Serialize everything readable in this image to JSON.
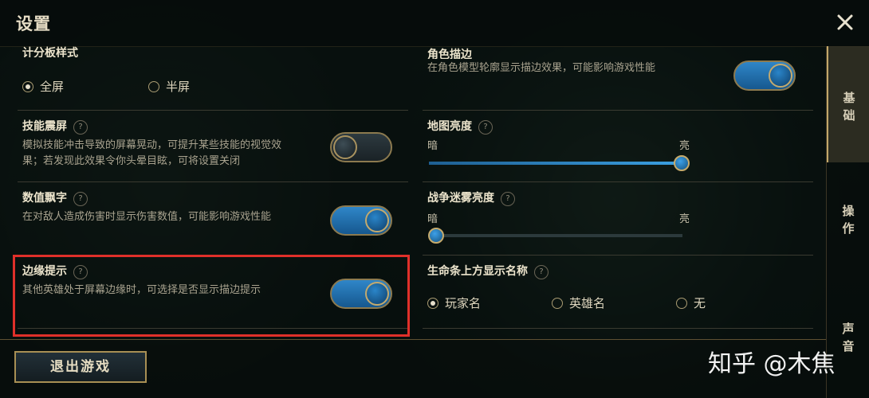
{
  "window": {
    "title": "设置"
  },
  "nav": {
    "tabs": [
      {
        "label": "基础"
      },
      {
        "label": "操作"
      },
      {
        "label": "声音"
      }
    ]
  },
  "sections": {
    "score_panel": {
      "name": "计分板样式",
      "options": [
        "全屏",
        "半屏"
      ],
      "selected": "全屏"
    },
    "outline": {
      "name": "角色描边",
      "desc": "在角色模型轮廓显示描边效果，可能影响游戏性能",
      "toggle": "on"
    },
    "shake": {
      "name": "技能震屏",
      "desc_1": "模拟技能冲击导致的屏幕晃动，可提升某些技能的视觉效",
      "desc_2": "果；若发现此效果令你头晕目眩，可将设置关闭",
      "toggle": "off"
    },
    "map_brightness": {
      "name": "地图亮度",
      "min_label": "暗",
      "max_label": "亮",
      "value": 1.0
    },
    "damage_text": {
      "name": "数值飘字",
      "desc": "在对敌人造成伤害时显示伤害数值，可能影响游戏性能",
      "toggle": "on"
    },
    "fog_brightness": {
      "name": "战争迷雾亮度",
      "min_label": "暗",
      "max_label": "亮",
      "value": 0.0
    },
    "edge_hint": {
      "name": "边缘提示",
      "desc": "其他英雄处于屏幕边缘时，可选择是否显示描边提示",
      "toggle": "on"
    },
    "healthbar_name": {
      "name": "生命条上方显示名称",
      "options": [
        "玩家名",
        "英雄名",
        "无"
      ],
      "selected": "玩家名"
    }
  },
  "help_glyph": "?",
  "footer": {
    "exit_label": "退出游戏"
  },
  "watermark": "知乎 @木焦",
  "colors": {
    "accent_gold": "#a88f54",
    "toggle_on": "#2f86c8",
    "highlight_border": "#e0302a"
  },
  "icons": {
    "close": "close-icon",
    "help": "help-icon"
  }
}
